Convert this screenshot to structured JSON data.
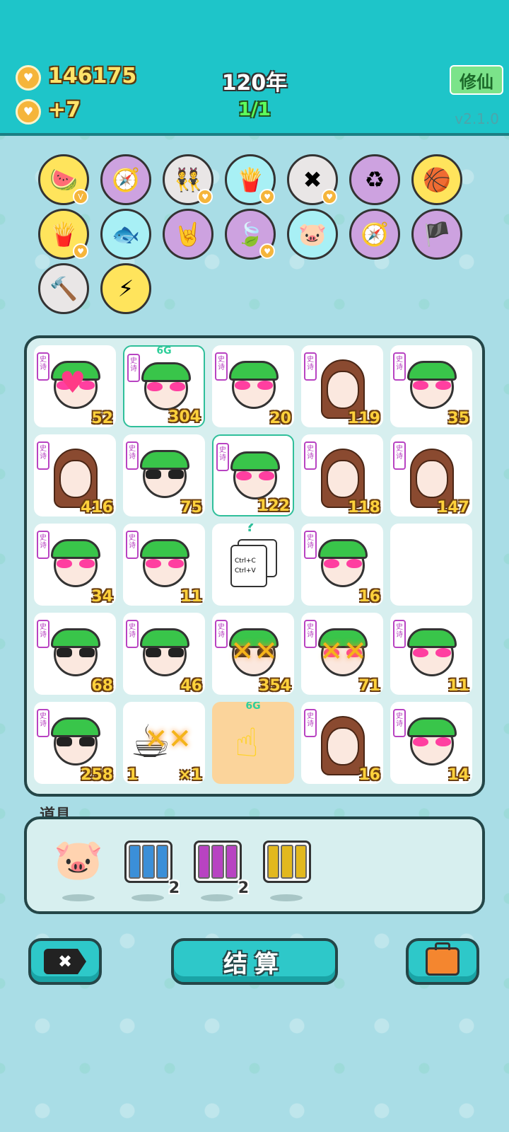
{
  "header": {
    "coins": "146175",
    "income": "+7",
    "years": "120年",
    "round": "1/1",
    "cultivate_label": "修仙",
    "version": "v2.1.0"
  },
  "items": [
    {
      "name": "fruit-bowl-icon",
      "glyph": "🍉",
      "bg": "#ffe45c",
      "badge": "V"
    },
    {
      "name": "compass-icon",
      "glyph": "🧭",
      "bg": "#cda2e0",
      "badge": ""
    },
    {
      "name": "twins-icon",
      "glyph": "👯",
      "bg": "#e9e6e6",
      "badge": "♥"
    },
    {
      "name": "fries-icon",
      "glyph": "🍟",
      "bg": "#a8f0f5",
      "badge": "♥"
    },
    {
      "name": "delete-tag-icon",
      "glyph": "✖",
      "bg": "#e9e6e6",
      "badge": "♥"
    },
    {
      "name": "recycle-icon",
      "glyph": "♻",
      "bg": "#cda2e0",
      "badge": ""
    },
    {
      "name": "basketballs-icon",
      "glyph": "🏀",
      "bg": "#ffe45c",
      "badge": ""
    },
    {
      "name": "fries-icon",
      "glyph": "🍟",
      "bg": "#ffe45c",
      "badge": "♥"
    },
    {
      "name": "fishbowl-icon",
      "glyph": "🐟",
      "bg": "#a8f0f5",
      "badge": ""
    },
    {
      "name": "rock-hand-icon",
      "glyph": "🤘",
      "bg": "#cda2e0",
      "badge": ""
    },
    {
      "name": "leaf-icon",
      "glyph": "🍃",
      "bg": "#cda2e0",
      "badge": "♥"
    },
    {
      "name": "piggy-bank-icon",
      "glyph": "🐷",
      "bg": "#a8f0f5",
      "badge": ""
    },
    {
      "name": "compass-icon",
      "glyph": "🧭",
      "bg": "#cda2e0",
      "badge": ""
    },
    {
      "name": "eyepatch-icon",
      "glyph": "🏴",
      "bg": "#cda2e0",
      "badge": ""
    },
    {
      "name": "hammer-icon",
      "glyph": "🔨",
      "bg": "#e9e6e6",
      "badge": ""
    },
    {
      "name": "lightning-icon",
      "glyph": "⚡",
      "bg": "#ffe45c",
      "badge": ""
    }
  ],
  "board": {
    "tag_text": "史诗",
    "top_label": "6G",
    "cells": [
      {
        "kind": "heart-guy",
        "num": "52"
      },
      {
        "kind": "heart-guy",
        "num": "304",
        "sel": true,
        "label": true
      },
      {
        "kind": "heart-guy",
        "num": "20"
      },
      {
        "kind": "girl",
        "num": "119"
      },
      {
        "kind": "heart-guy",
        "num": "35"
      },
      {
        "kind": "girl",
        "num": "416"
      },
      {
        "kind": "shades-guy",
        "num": "75"
      },
      {
        "kind": "heart-guy",
        "num": "122",
        "sel": true
      },
      {
        "kind": "girl",
        "num": "118"
      },
      {
        "kind": "girl",
        "num": "147"
      },
      {
        "kind": "heart-guy",
        "num": "34"
      },
      {
        "kind": "heart-guy",
        "num": "11"
      },
      {
        "kind": "ctrl",
        "num": "",
        "ctrl1": "Ctrl+C",
        "ctrl2": "Ctrl+V",
        "qmark": "?"
      },
      {
        "kind": "heart-guy",
        "num": "16"
      },
      {
        "kind": "empty",
        "num": ""
      },
      {
        "kind": "shades-guy",
        "num": "68"
      },
      {
        "kind": "shades-guy",
        "num": "46"
      },
      {
        "kind": "shades-guy",
        "num": "354",
        "fx": true
      },
      {
        "kind": "heart-guy",
        "num": "71",
        "fx": true
      },
      {
        "kind": "heart-guy",
        "num": "11"
      },
      {
        "kind": "shades-guy",
        "num": "258"
      },
      {
        "kind": "cup",
        "num": "×1",
        "left": "1"
      },
      {
        "kind": "pointer",
        "num": "",
        "label": true
      },
      {
        "kind": "girl",
        "num": "16"
      },
      {
        "kind": "heart-guy",
        "num": "14"
      }
    ]
  },
  "props": {
    "title": "道具",
    "items": [
      {
        "name": "piggy-bank-prop",
        "count": ""
      },
      {
        "name": "rare-cards-prop",
        "count": "2",
        "color": "#3b8fd8"
      },
      {
        "name": "epic-cards-prop",
        "count": "2",
        "color": "#b843c2"
      },
      {
        "name": "legend-cards-prop",
        "count": "",
        "color": "#e2b81e"
      }
    ]
  },
  "buttons": {
    "settle_label": "结算"
  }
}
